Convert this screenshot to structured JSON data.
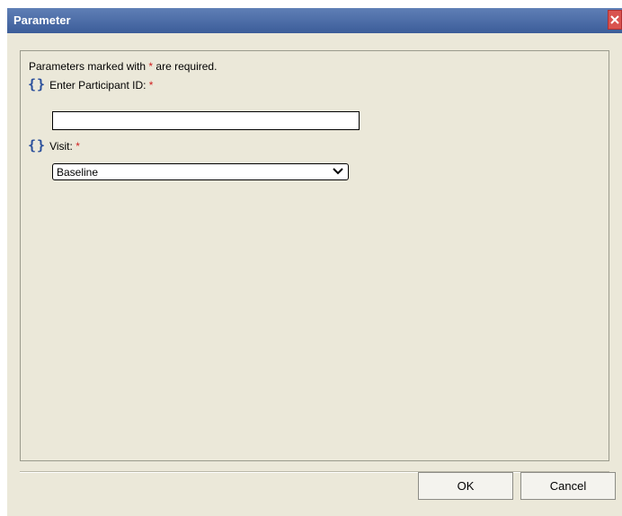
{
  "dialog": {
    "title": "Parameter",
    "close_icon": "close-x-icon",
    "close_color": "#d9534f",
    "title_bar_color": "#4b6ca8",
    "background_color": "#ebe8d9"
  },
  "form": {
    "required_note_prefix": "Parameters marked with ",
    "required_star": "*",
    "required_note_suffix": " are required.",
    "params": [
      {
        "icon": "curly-braces-icon",
        "icon_glyph": "{}",
        "label": "Enter Participant ID:",
        "required": "*",
        "value": ""
      },
      {
        "icon": "curly-braces-icon",
        "icon_glyph": "{}",
        "label": "Visit:",
        "required": "*",
        "selected": "Baseline"
      }
    ]
  },
  "buttons": {
    "ok": "OK",
    "cancel": "Cancel"
  }
}
